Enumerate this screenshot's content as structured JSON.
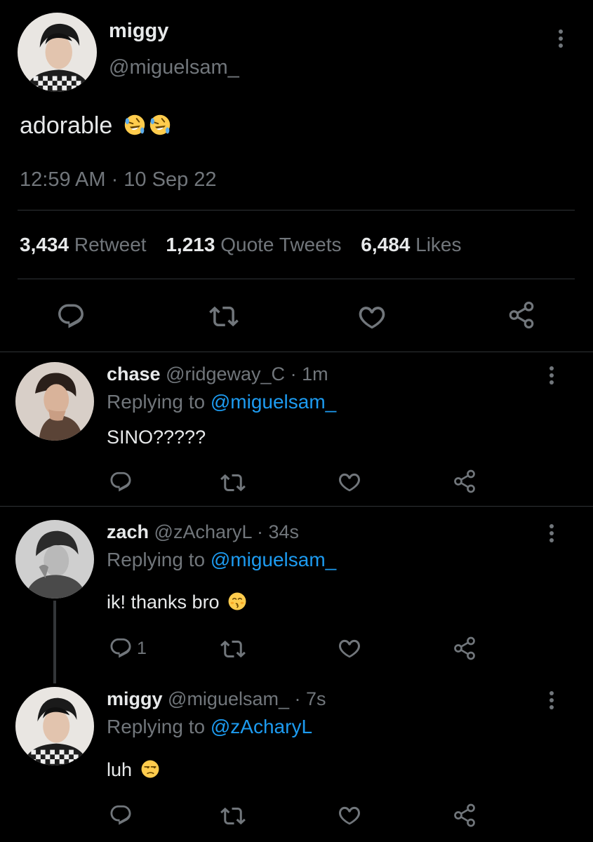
{
  "main_tweet": {
    "display_name": "miggy",
    "handle": "@miguelsam_",
    "text": "adorable",
    "emojis": [
      "rolling-on-floor-laughing",
      "rolling-on-floor-laughing"
    ],
    "timestamp": "12:59 AM · 10 Sep 22",
    "stats": [
      {
        "count": "3,434",
        "label": "Retweet"
      },
      {
        "count": "1,213",
        "label": "Quote Tweets"
      },
      {
        "count": "6,484",
        "label": "Likes"
      }
    ]
  },
  "replies": [
    {
      "display_name": "chase",
      "handle": "@ridgeway_C",
      "time": "· 1m",
      "replying_prefix": "Replying to",
      "replying_to": "@miguelsam_",
      "text": "SINO?????",
      "reply_count": ""
    },
    {
      "display_name": "zach",
      "handle": "@zAcharyL",
      "time": "· 34s",
      "replying_prefix": "Replying to",
      "replying_to": "@miguelsam_",
      "text": "ik! thanks bro",
      "emoji": "kissing-face",
      "reply_count": "1"
    },
    {
      "display_name": "miggy",
      "handle": "@miguelsam_",
      "time": "· 7s",
      "replying_prefix": "Replying to",
      "replying_to": "@zAcharyL",
      "text": "luh",
      "emoji": "unamused-face",
      "reply_count": ""
    }
  ],
  "colors": {
    "background": "#000000",
    "text": "#e7e9ea",
    "secondary": "#71767b",
    "link": "#1d9bf0",
    "divider": "#2f3336"
  }
}
